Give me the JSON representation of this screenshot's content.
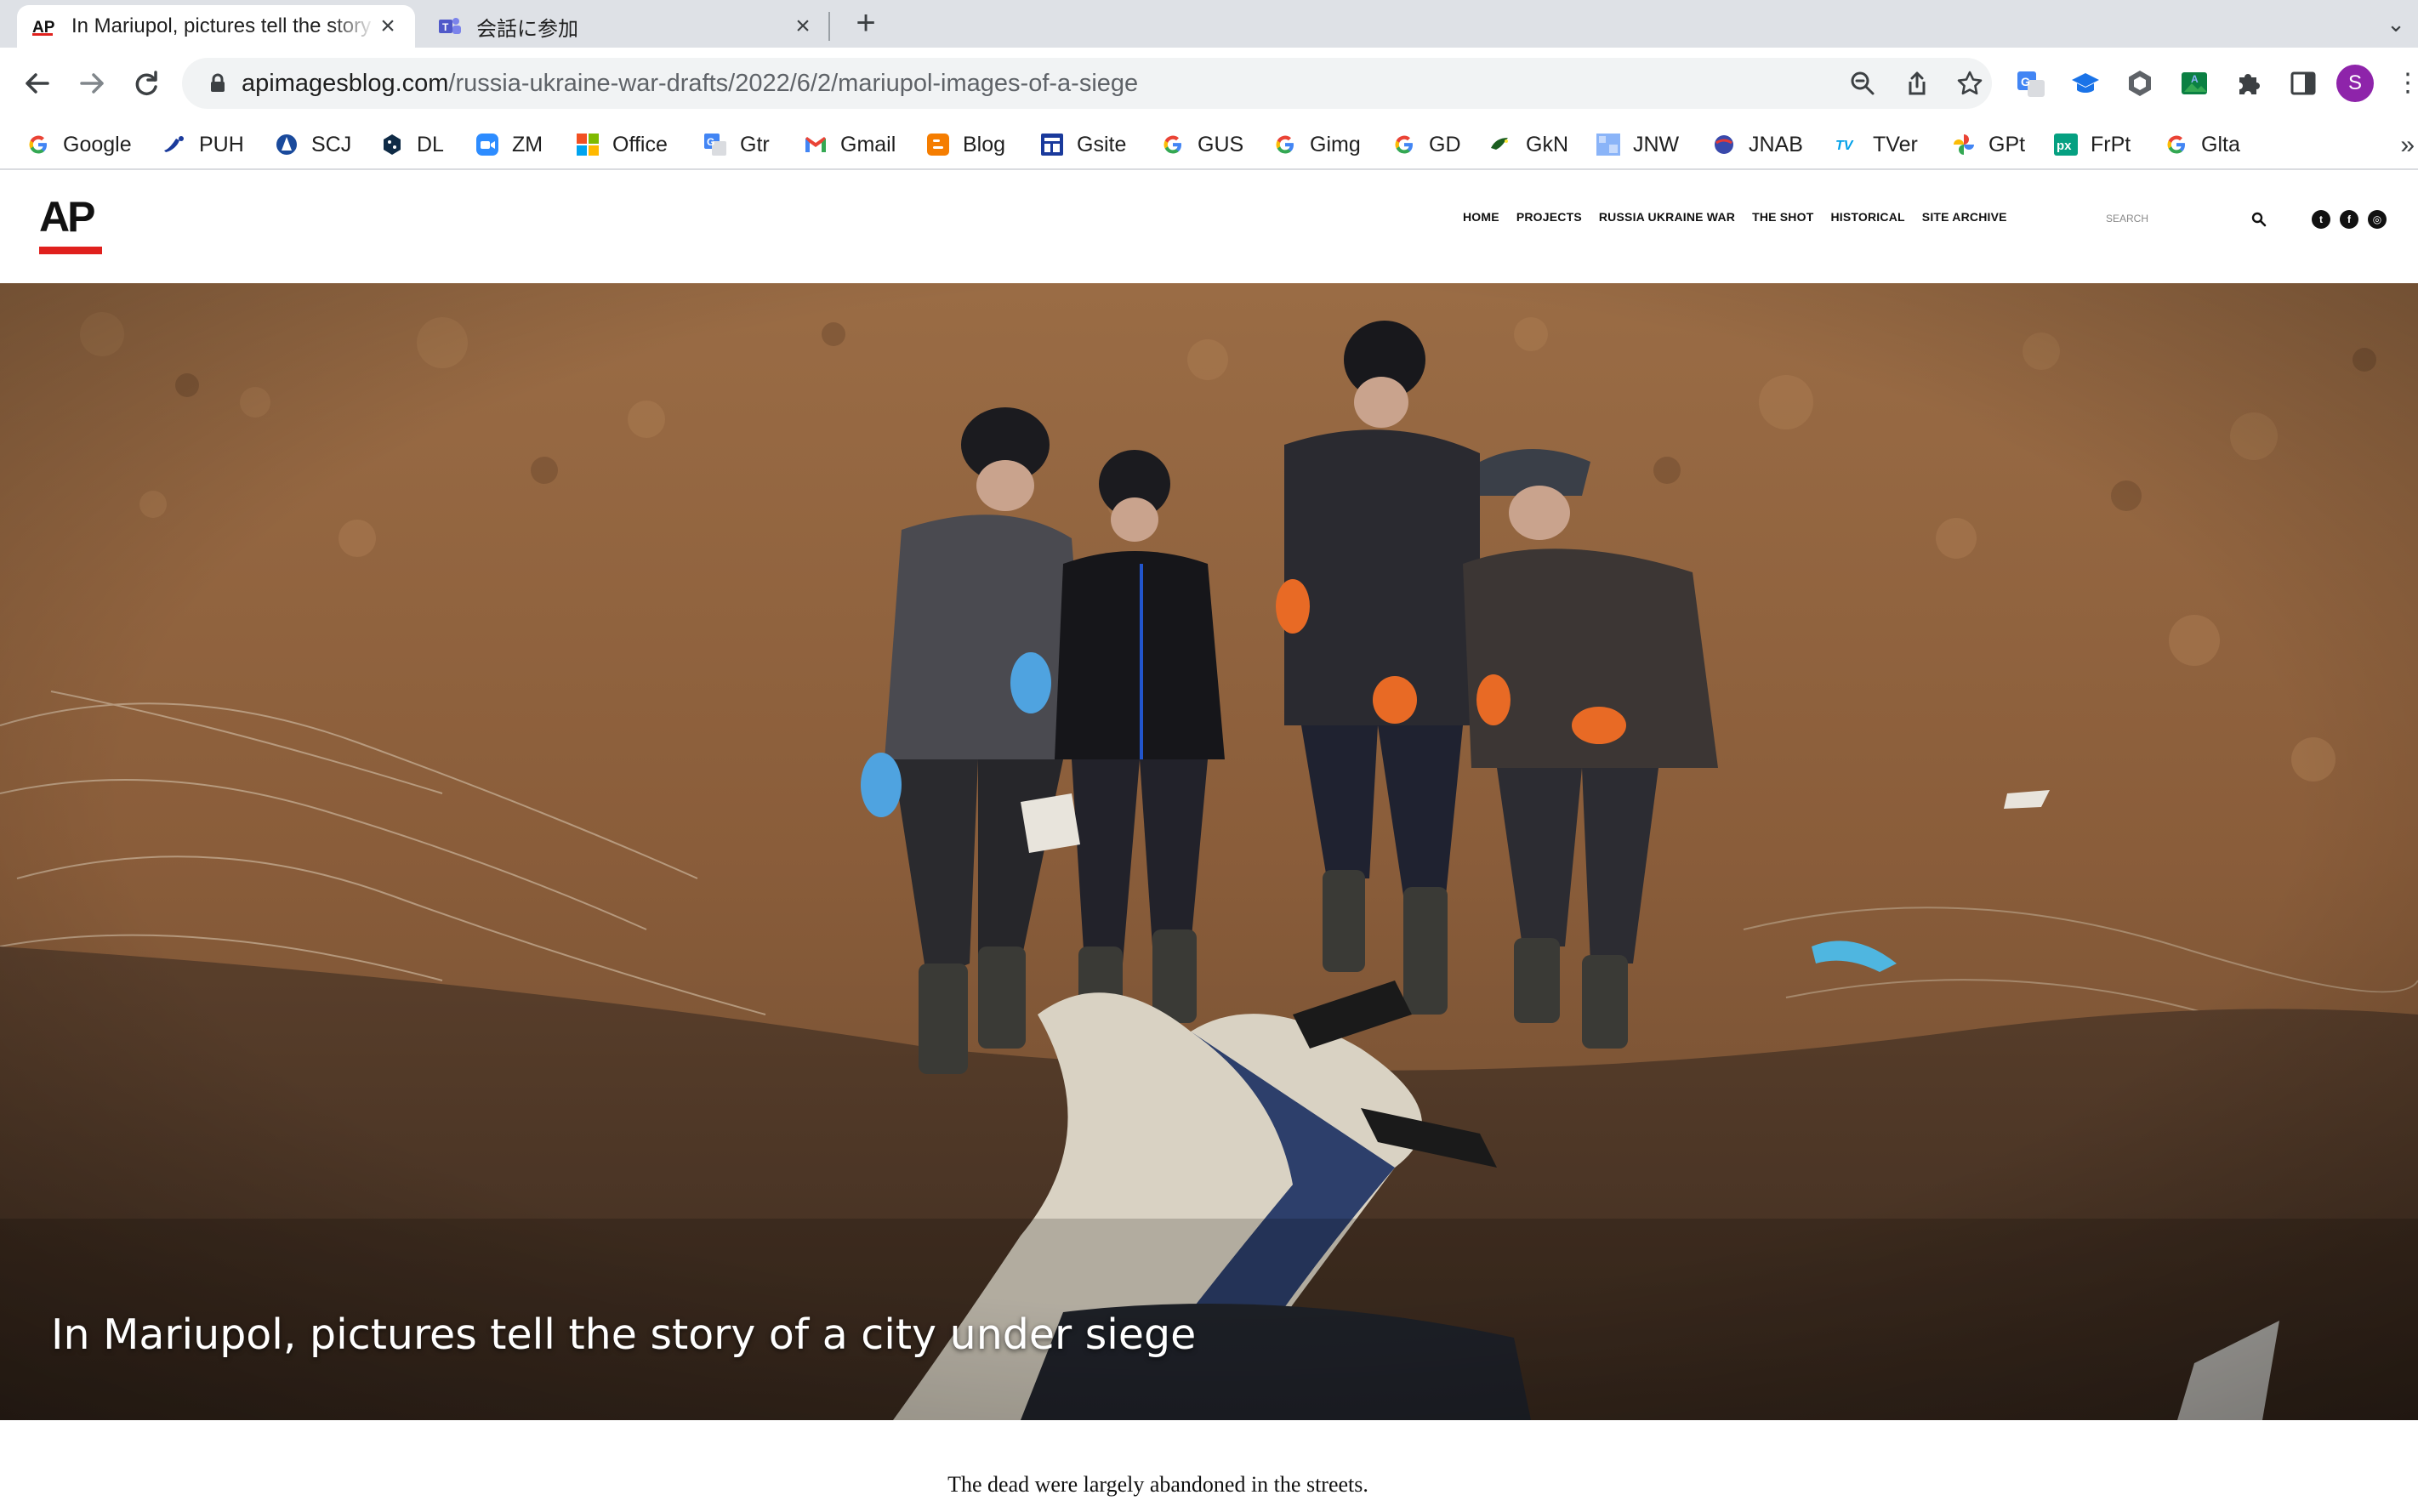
{
  "tabs": [
    {
      "title": "In Mariupol, pictures tell the story of a city under siege",
      "favicon": "ap-favicon",
      "active": true
    },
    {
      "title": "会話に参加",
      "favicon": "teams-icon",
      "active": false
    }
  ],
  "toolbar": {
    "url_host": "apimagesblog.com",
    "url_path": "/russia-ukraine-war-drafts/2022/6/2/mariupol-images-of-a-siege",
    "profile_initial": "S"
  },
  "bookmarks": [
    {
      "label": "Google",
      "icon": "google-icon"
    },
    {
      "label": "PUH",
      "icon": "puh-icon"
    },
    {
      "label": "SCJ",
      "icon": "scj-icon"
    },
    {
      "label": "DL",
      "icon": "deepl-icon"
    },
    {
      "label": "ZM",
      "icon": "zoom-icon"
    },
    {
      "label": "Office",
      "icon": "office-icon"
    },
    {
      "label": "Gtr",
      "icon": "google-translate-icon"
    },
    {
      "label": "Gmail",
      "icon": "gmail-icon"
    },
    {
      "label": "Blog",
      "icon": "blogger-icon"
    },
    {
      "label": "Gsite",
      "icon": "google-sites-icon"
    },
    {
      "label": "GUS",
      "icon": "google-icon"
    },
    {
      "label": "Gimg",
      "icon": "google-icon"
    },
    {
      "label": "GD",
      "icon": "google-icon"
    },
    {
      "label": "GkN",
      "icon": "gkn-icon"
    },
    {
      "label": "JNW",
      "icon": "jnw-icon"
    },
    {
      "label": "JNAB",
      "icon": "jnab-icon"
    },
    {
      "label": "TVer",
      "icon": "tver-icon"
    },
    {
      "label": "GPt",
      "icon": "google-photos-icon"
    },
    {
      "label": "FrPt",
      "icon": "pixlr-icon"
    },
    {
      "label": "Glta",
      "icon": "google-icon"
    }
  ],
  "site": {
    "logo": "AP",
    "nav": [
      "HOME",
      "PROJECTS",
      "RUSSIA UKRAINE WAR",
      "THE SHOT",
      "HISTORICAL",
      "SITE ARCHIVE"
    ],
    "search_placeholder": "SEARCH",
    "hero_title": "In Mariupol, pictures tell the story of a city under siege",
    "caption": "The dead were largely abandoned in the streets.",
    "social": [
      "twitter-icon",
      "facebook-icon",
      "instagram-icon"
    ]
  },
  "colors": {
    "accent_red": "#e0201d",
    "tab_strip": "#dee1e6",
    "omnibox": "#f1f3f4",
    "profile": "#8e24aa"
  }
}
